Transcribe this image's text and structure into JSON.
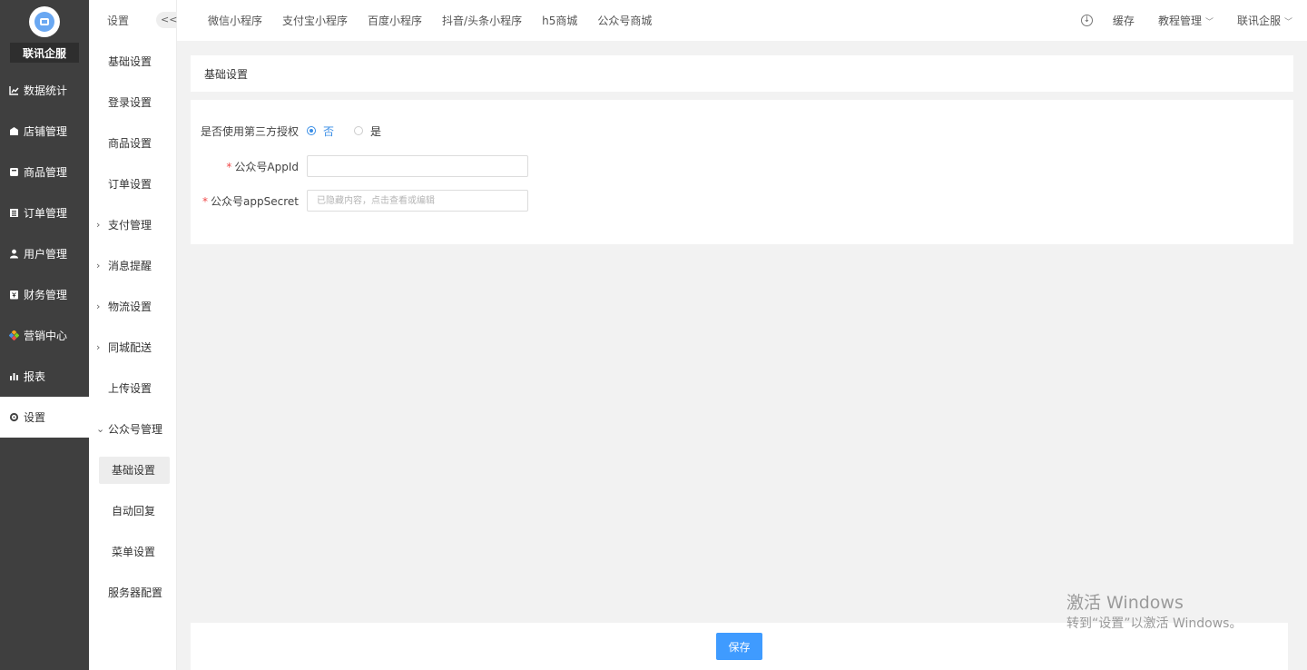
{
  "brand": {
    "name": "联讯企服"
  },
  "mainnav": [
    {
      "label": "数据统计",
      "icon": "line-chart-icon"
    },
    {
      "label": "店铺管理",
      "icon": "store-icon"
    },
    {
      "label": "商品管理",
      "icon": "goods-icon"
    },
    {
      "label": "订单管理",
      "icon": "order-icon"
    },
    {
      "label": "用户管理",
      "icon": "user-icon"
    },
    {
      "label": "财务管理",
      "icon": "finance-icon"
    },
    {
      "label": "营销中心",
      "icon": "marketing-icon"
    },
    {
      "label": "报表",
      "icon": "report-icon"
    },
    {
      "label": "设置",
      "icon": "gear-icon",
      "active": true
    }
  ],
  "subnav": {
    "title": "设置",
    "collapse_label": "<<",
    "items": [
      {
        "label": "基础设置"
      },
      {
        "label": "登录设置"
      },
      {
        "label": "商品设置"
      },
      {
        "label": "订单设置"
      },
      {
        "label": "支付管理",
        "arrow": "right"
      },
      {
        "label": "消息提醒",
        "arrow": "right"
      },
      {
        "label": "物流设置",
        "arrow": "right"
      },
      {
        "label": "同城配送",
        "arrow": "right"
      },
      {
        "label": "上传设置"
      },
      {
        "label": "公众号管理",
        "arrow": "down"
      },
      {
        "label": "基础设置",
        "child": true,
        "active": true
      },
      {
        "label": "自动回复",
        "child": true
      },
      {
        "label": "菜单设置",
        "child": true
      },
      {
        "label": "服务器配置"
      }
    ]
  },
  "topbar": {
    "tabs": [
      "微信小程序",
      "支付宝小程序",
      "百度小程序",
      "抖音/头条小程序",
      "h5商城",
      "公众号商城"
    ],
    "cache_label": "缓存",
    "tutorial_label": "教程管理",
    "account_label": "联讯企服"
  },
  "content": {
    "header_title": "基础设置",
    "third_party": {
      "label": "是否使用第三方授权",
      "options": [
        "否",
        "是"
      ],
      "selected": "否"
    },
    "appid": {
      "label": "公众号AppId",
      "value": "",
      "placeholder": ""
    },
    "appsecret": {
      "label": "公众号appSecret",
      "value": "",
      "placeholder": "已隐藏内容，点击查看或编辑"
    }
  },
  "footer": {
    "save_label": "保存"
  },
  "watermark": {
    "line1": "激活 Windows",
    "line2": "转到“设置”以激活 Windows。"
  },
  "colors": {
    "nav_bg": "#3f3f3f",
    "accent": "#3f9bff",
    "radio_active": "#3a8ee6",
    "required": "#f04848"
  }
}
